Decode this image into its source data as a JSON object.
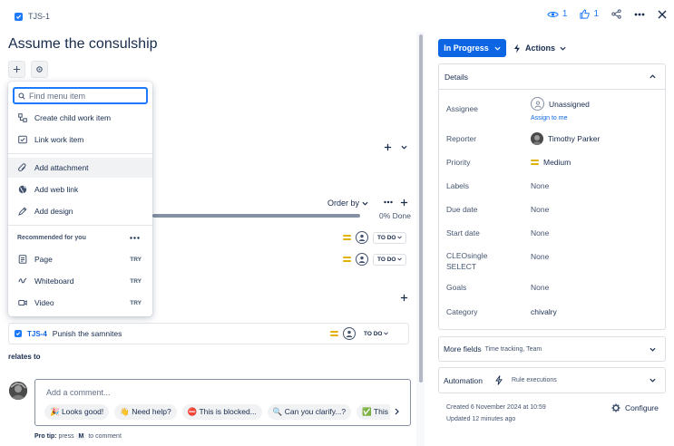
{
  "issue": {
    "key": "TJS-1",
    "title": "Assume the consulship"
  },
  "header": {
    "watchers_count": "1",
    "votes_count": "1"
  },
  "menu": {
    "search_placeholder": "Find menu item",
    "items": [
      {
        "label": "Create child work item",
        "icon": "child-items-icon"
      },
      {
        "label": "Link work item",
        "icon": "link-issue-icon"
      },
      {
        "label": "Add attachment",
        "icon": "paperclip-icon"
      },
      {
        "label": "Add web link",
        "icon": "globe-icon"
      },
      {
        "label": "Add design",
        "icon": "design-icon"
      }
    ],
    "recommended_header": "Recommended for you",
    "recommended": [
      {
        "label": "Page",
        "badge": "TRY",
        "icon": "page-icon"
      },
      {
        "label": "Whiteboard",
        "badge": "TRY",
        "icon": "whiteboard-icon"
      },
      {
        "label": "Video",
        "badge": "TRY",
        "icon": "video-icon"
      }
    ]
  },
  "child_items": {
    "order_by_label": "Order by",
    "progress_fraction": 0,
    "progress_text": "0% Done",
    "rows": [
      {
        "status": "TO DO"
      },
      {
        "status": "TO DO"
      }
    ]
  },
  "child_issue": {
    "key": "TJS-4",
    "summary": "Punish the samnites",
    "status": "TO DO"
  },
  "relates_to_label": "relates to",
  "comment": {
    "placeholder": "Add a comment...",
    "chips": [
      "🎉 Looks good!",
      "👋 Need help?",
      "⛔ This is blocked...",
      "🔍 Can you clarify...?",
      "✅ This"
    ],
    "pro_tip_prefix": "Pro tip:",
    "pro_tip_mid": "press",
    "pro_tip_key": "M",
    "pro_tip_suffix": "to comment"
  },
  "status_button": {
    "label": "In Progress"
  },
  "actions_button": {
    "label": "Actions"
  },
  "details": {
    "header": "Details",
    "fields": {
      "assignee": {
        "label": "Assignee",
        "value": "Unassigned",
        "link": "Assign to me"
      },
      "reporter": {
        "label": "Reporter",
        "value": "Timothy Parker"
      },
      "priority": {
        "label": "Priority",
        "value": "Medium"
      },
      "labels": {
        "label": "Labels",
        "value": "None"
      },
      "due_date": {
        "label": "Due date",
        "value": "None"
      },
      "start_date": {
        "label": "Start date",
        "value": "None"
      },
      "cleo": {
        "label_line1": "CLEOsingle",
        "label_line2": "SELECT",
        "value": "None"
      },
      "goals": {
        "label": "Goals",
        "value": "None"
      },
      "category": {
        "label": "Category",
        "value": "chivalry"
      }
    }
  },
  "more_fields": {
    "label": "More fields",
    "sub": "Time tracking, Team"
  },
  "automation": {
    "label": "Automation",
    "sub": "Rule executions"
  },
  "meta": {
    "created": "Created 6 November 2024 at 10:59",
    "updated": "Updated 12 minutes ago"
  },
  "configure_label": "Configure",
  "colors": {
    "brand_blue": "#0c66e4",
    "priority_medium": "#e2b203"
  }
}
